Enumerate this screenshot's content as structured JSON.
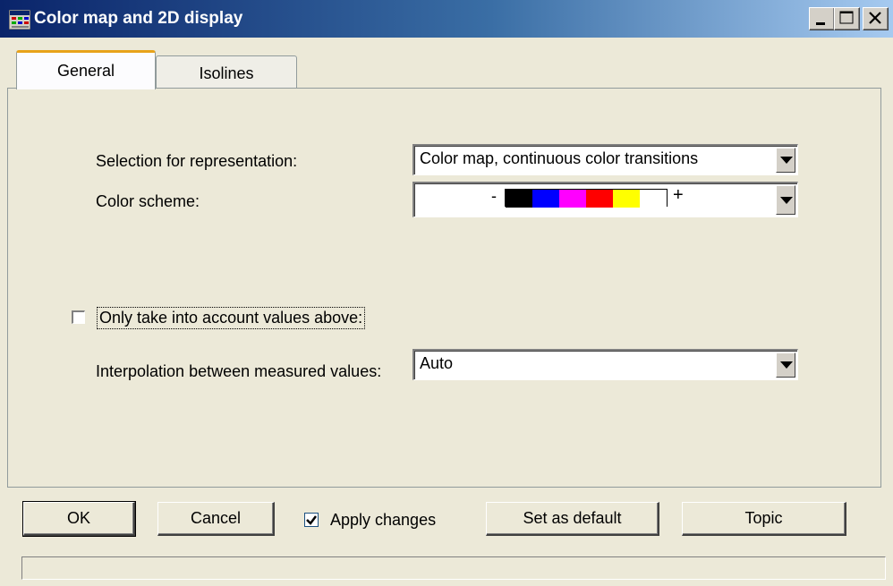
{
  "window": {
    "title": "Color map and 2D display"
  },
  "tabs": [
    {
      "label": "General",
      "active": true
    },
    {
      "label": "Isolines",
      "active": false
    }
  ],
  "general": {
    "selection_label": "Selection for representation:",
    "selection_value": "Color map, continuous color transitions",
    "color_scheme_label": "Color scheme:",
    "color_scheme": {
      "minus": "-",
      "plus": "+",
      "colors": [
        "#000000",
        "#0000ff",
        "#ff00ff",
        "#ff0000",
        "#ffff00",
        "#ffffff"
      ]
    },
    "only_values_above": {
      "label": "Only take into account values above:",
      "checked": false
    },
    "interpolation_label": "Interpolation between measured values:",
    "interpolation_value": "Auto"
  },
  "buttons": {
    "ok": "OK",
    "cancel": "Cancel",
    "apply_changes_label": "Apply changes",
    "apply_changes_checked": true,
    "set_default": "Set as default",
    "topic": "Topic"
  },
  "icons": {
    "app": "color-map-window-icon",
    "minimize": "minimize-icon",
    "maximize": "maximize-icon",
    "close": "close-icon",
    "dropdown": "dropdown-arrow-icon",
    "check": "checkmark-icon"
  }
}
